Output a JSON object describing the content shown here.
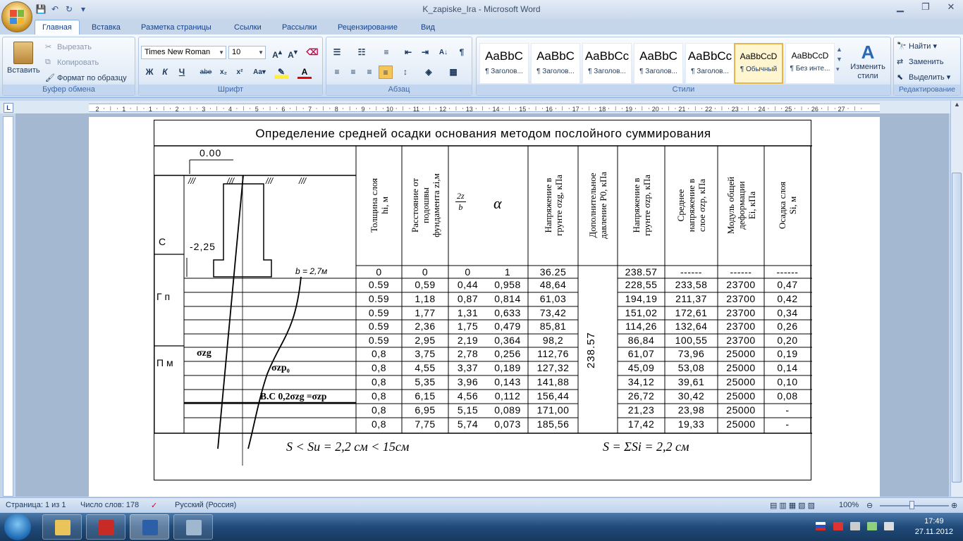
{
  "window": {
    "title": "K_zapiske_Ira - Microsoft Word"
  },
  "tabs": [
    "Главная",
    "Вставка",
    "Разметка страницы",
    "Ссылки",
    "Рассылки",
    "Рецензирование",
    "Вид"
  ],
  "ribbon": {
    "clipboard": {
      "label": "Буфер обмена",
      "paste": "Вставить",
      "cut": "Вырезать",
      "copy": "Копировать",
      "format_painter": "Формат по образцу"
    },
    "font": {
      "label": "Шрифт",
      "name": "Times New Roman",
      "size": "10"
    },
    "paragraph": {
      "label": "Абзац"
    },
    "styles": {
      "label": "Стили",
      "items": [
        {
          "sample": "AaBbC",
          "name": "¶ Заголов..."
        },
        {
          "sample": "AaBbC",
          "name": "¶ Заголов..."
        },
        {
          "sample": "AaBbCc",
          "name": "¶ Заголов..."
        },
        {
          "sample": "AaBbC",
          "name": "¶ Заголов..."
        },
        {
          "sample": "AaBbCc",
          "name": "¶ Заголов..."
        },
        {
          "sample": "AaBbCcD",
          "name": "¶ Обычный"
        },
        {
          "sample": "AaBbCcD",
          "name": "¶ Без инте..."
        }
      ],
      "change": "Изменить стили"
    },
    "editing": {
      "label": "Редактирование",
      "find": "Найти",
      "replace": "Заменить",
      "select": "Выделить"
    }
  },
  "ruler": {
    "marks": [
      "2",
      "1",
      "1",
      "2",
      "3",
      "4",
      "5",
      "6",
      "7",
      "8",
      "9",
      "10",
      "11",
      "12",
      "13",
      "14",
      "15",
      "16",
      "17",
      "18",
      "19",
      "20",
      "21",
      "22",
      "23",
      "24",
      "25",
      "26",
      "27"
    ]
  },
  "table": {
    "title": "Определение средней осадки основания методом послойного суммирования",
    "headers": [
      "Толщина слоя hi, м",
      "Расстояние от подошвы фундамента zi,м",
      "2z/b",
      "α",
      "Напряжение в грунте σzg, кПа",
      "Дополнительное давление P0, кПа",
      "Напряжение в грунте σzp, кПа",
      "Среднее напряжение в слое σzp, кПа",
      "Модуль общей деформации Ei, кПа",
      "Осадка слоя Si, м"
    ],
    "header_lines": [
      [
        "Толщина слоя",
        "hi, м"
      ],
      [
        "Расстояние от",
        "подошвы",
        "фундамента zi,м"
      ],
      [
        "2z",
        "b"
      ],
      [
        "α"
      ],
      [
        "Напряжение в",
        "грунте σzg, кПа"
      ],
      [
        "Дополнительное",
        "давление P0, кПа"
      ],
      [
        "Напряжение в",
        "грунте σzp, кПа"
      ],
      [
        "Среднее",
        "напряжение в",
        "слое σzp, кПа"
      ],
      [
        "Модуль общей",
        "деформации",
        "Ei, кПа"
      ],
      [
        "Осадка слоя",
        "Si, м"
      ]
    ],
    "p0": "238.57",
    "rows": [
      [
        "0",
        "0",
        "0",
        "1",
        "36.25",
        "238.57",
        "------",
        "------",
        "------"
      ],
      [
        "0.59",
        "0,59",
        "0,44",
        "0,958",
        "48,64",
        "228,55",
        "233,58",
        "23700",
        "0,47"
      ],
      [
        "0.59",
        "1,18",
        "0,87",
        "0,814",
        "61,03",
        "194,19",
        "211,37",
        "23700",
        "0,42"
      ],
      [
        "0.59",
        "1,77",
        "1,31",
        "0,633",
        "73,42",
        "151,02",
        "172,61",
        "23700",
        "0,34"
      ],
      [
        "0.59",
        "2,36",
        "1,75",
        "0,479",
        "85,81",
        "114,26",
        "132,64",
        "23700",
        "0,26"
      ],
      [
        "0.59",
        "2,95",
        "2,19",
        "0,364",
        "98,2",
        "86,84",
        "100,55",
        "23700",
        "0,20"
      ],
      [
        "0,8",
        "3,75",
        "2,78",
        "0,256",
        "112,76",
        "61,07",
        "73,96",
        "25000",
        "0,19"
      ],
      [
        "0,8",
        "4,55",
        "3,37",
        "0,189",
        "127,32",
        "45,09",
        "53,08",
        "25000",
        "0,14"
      ],
      [
        "0,8",
        "5,35",
        "3,96",
        "0,143",
        "141,88",
        "34,12",
        "39,61",
        "25000",
        "0,10"
      ],
      [
        "0,8",
        "6,15",
        "4,56",
        "0,112",
        "156,44",
        "26,72",
        "30,42",
        "25000",
        "0,08"
      ],
      [
        "0,8",
        "6,95",
        "5,15",
        "0,089",
        "171,00",
        "21,23",
        "23,98",
        "25000",
        "-"
      ],
      [
        "0,8",
        "7,75",
        "5,74",
        "0,073",
        "185,56",
        "17,42",
        "19,33",
        "25000",
        "-"
      ]
    ],
    "sketch": {
      "level_top": "0.00",
      "level_base": "-2,25",
      "b_label": "b = 2,7м",
      "soil_1": "С",
      "soil_2": "Г п",
      "soil_3": "П м",
      "szg": "σzg",
      "szp": "σzp₀",
      "vs": "В.С 0,2σzg =σzp"
    },
    "formula_left": "S < Su = 2,2 см < 15см",
    "formula_right": "S = ΣSi = 2,2 см"
  },
  "status": {
    "page": "Страница: 1 из 1",
    "words": "Число слов: 178",
    "lang": "Русский (Россия)",
    "zoom": "100%"
  },
  "taskbar": {
    "time": "17:49",
    "date": "27.11.2012"
  }
}
